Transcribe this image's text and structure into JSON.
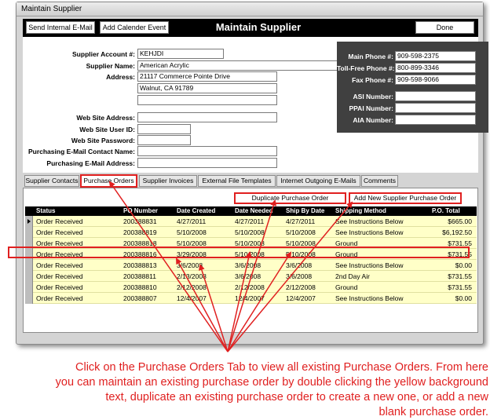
{
  "window": {
    "title": "Maintain Supplier"
  },
  "header": {
    "send_email_label": "Send Internal E-Mail",
    "calendar_label": "Add Calender Event",
    "title": "Maintain Supplier",
    "done_label": "Done"
  },
  "supplier": {
    "account_label": "Supplier Account #:",
    "account": "KEHJDI",
    "name_label": "Supplier Name:",
    "name": "American Acrylic",
    "address_label": "Address:",
    "address1": "21117 Commerce Pointe Drive",
    "address2": "Walnut, CA 91789",
    "address3": "",
    "website_label": "Web Site Address:",
    "website": "",
    "userid_label": "Web Site User ID:",
    "userid": "",
    "password_label": "Web Site Password:",
    "password": "",
    "po_contact_label": "Purchasing E-Mail Contact Name:",
    "po_contact": "",
    "po_email_label": "Purchasing E-Mail Address:",
    "po_email": ""
  },
  "phones": {
    "main_label": "Main Phone #:",
    "main": "909-598-2375",
    "tollfree_label": "Toll-Free Phone #:",
    "tollfree": "800-899-3346",
    "fax_label": "Fax Phone #:",
    "fax": "909-598-9066",
    "asi_label": "ASI Number:",
    "asi": "",
    "ppai_label": "PPAI Number:",
    "ppai": "",
    "aia_label": "AIA Number:",
    "aia": ""
  },
  "tabs": [
    {
      "label": "Supplier Contacts"
    },
    {
      "label": "Purchase Orders"
    },
    {
      "label": "Supplier Invoices"
    },
    {
      "label": "External File Templates"
    },
    {
      "label": "Internet Outgoing E-Mails"
    },
    {
      "label": "Comments"
    }
  ],
  "panel": {
    "duplicate_label": "Duplicate Purchase Order",
    "add_label": "Add New Supplier Purchase Order"
  },
  "table": {
    "columns": [
      "Status",
      "PO Number",
      "Date Created",
      "Date Needed",
      "Ship By Date",
      "Shipping Method",
      "P.O. Total"
    ],
    "rows": [
      {
        "status": "Order Received",
        "po": "200388831",
        "created": "4/27/2011",
        "needed": "4/27/2011",
        "ship": "4/27/2011",
        "method": "See Instructions Below",
        "total": "$665.00"
      },
      {
        "status": "Order Received",
        "po": "200388819",
        "created": "5/10/2008",
        "needed": "5/10/2008",
        "ship": "5/10/2008",
        "method": "See Instructions Below",
        "total": "$6,192.50"
      },
      {
        "status": "Order Received",
        "po": "200388818",
        "created": "5/10/2008",
        "needed": "5/10/2008",
        "ship": "5/10/2008",
        "method": "Ground",
        "total": "$731.55"
      },
      {
        "status": "Order Received",
        "po": "200388816",
        "created": "3/29/2008",
        "needed": "5/10/2008",
        "ship": "5/10/2008",
        "method": "Ground",
        "total": "$731.55"
      },
      {
        "status": "Order Received",
        "po": "200388813",
        "created": "3/6/2008",
        "needed": "3/6/2008",
        "ship": "3/6/2008",
        "method": "See Instructions Below",
        "total": "$0.00"
      },
      {
        "status": "Order Received",
        "po": "200388811",
        "created": "2/13/2008",
        "needed": "3/6/2008",
        "ship": "3/6/2008",
        "method": "2nd Day Air",
        "total": "$731.55"
      },
      {
        "status": "Order Received",
        "po": "200388810",
        "created": "2/12/2008",
        "needed": "2/12/2008",
        "ship": "2/12/2008",
        "method": "Ground",
        "total": "$731.55"
      },
      {
        "status": "Order Received",
        "po": "200388807",
        "created": "12/4/2007",
        "needed": "12/4/2007",
        "ship": "12/4/2007",
        "method": "See Instructions Below",
        "total": "$0.00"
      }
    ]
  },
  "caption": {
    "line1": "Click on the Purchase Orders Tab to view all existing Purchase Orders.  From here",
    "line2": "you can maintain an existing purchase order by double clicking the yellow background",
    "line3": "text, duplicate an existing purchase order to create a new one, or add a new",
    "line4": "blank purchase order."
  },
  "colors": {
    "annotation": "#e02020",
    "row_background": "#ffffc8",
    "header": "#000000"
  }
}
